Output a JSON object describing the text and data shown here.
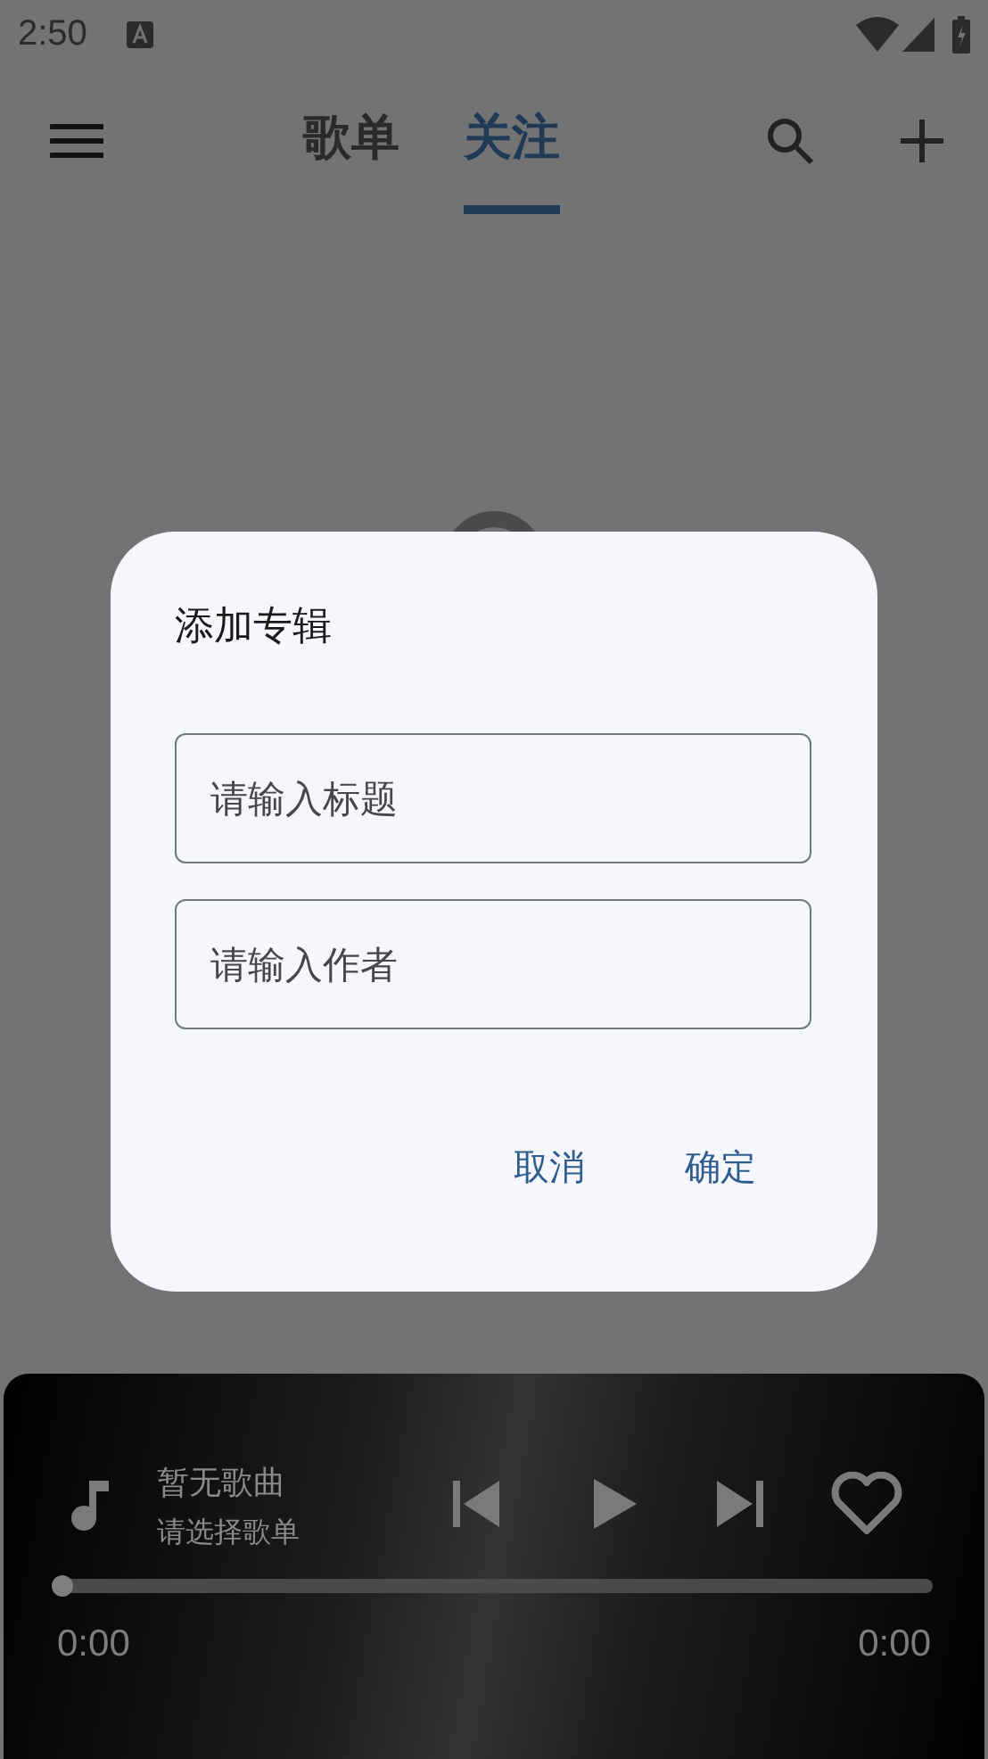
{
  "status_bar": {
    "time": "2:50"
  },
  "tabs": [
    {
      "label": "歌单",
      "selected": false
    },
    {
      "label": "关注",
      "selected": true
    }
  ],
  "dialog": {
    "title": "添加专辑",
    "fields": [
      {
        "placeholder": "请输入标题"
      },
      {
        "placeholder": "请输入作者"
      }
    ],
    "buttons": [
      "取消",
      "确定"
    ]
  },
  "player": {
    "title": "暂无歌曲",
    "subtitle": "请选择歌单",
    "progress": {
      "level": 0
    },
    "elapsed": "0:00",
    "duration": "0:00"
  }
}
